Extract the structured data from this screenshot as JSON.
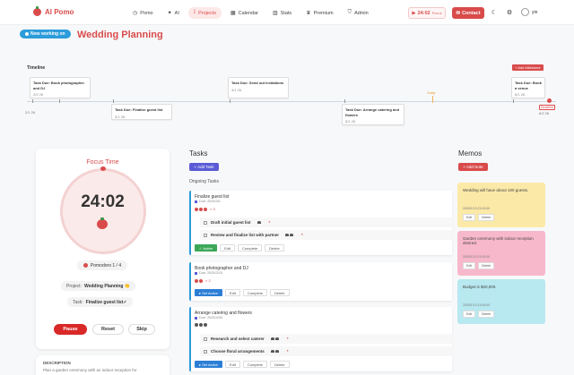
{
  "header": {
    "app_name": "AI Pomo",
    "nav": [
      {
        "icon": "clock-icon",
        "glyph": "◷",
        "label": "Pomo"
      },
      {
        "icon": "sparkle-icon",
        "glyph": "✦",
        "label": "AI"
      },
      {
        "icon": "projects-icon",
        "glyph": "⟟",
        "label": "Projects"
      },
      {
        "icon": "calendar-icon",
        "glyph": "▦",
        "label": "Calendar"
      },
      {
        "icon": "stats-icon",
        "glyph": "▥",
        "label": "Stats"
      },
      {
        "icon": "crown-icon",
        "glyph": "♛",
        "label": "Premium"
      },
      {
        "icon": "shield-icon",
        "glyph": "⛉",
        "label": "Admin"
      }
    ],
    "timer_pill": {
      "time": "24:02",
      "mode": "Focus"
    },
    "contact_label": "Contact",
    "user_initials": "yin"
  },
  "working_on": {
    "badge": "Now working on",
    "project": "Wedding Planning"
  },
  "timeline": {
    "label": "Timeline",
    "add_milestone": "+ Add Milestone",
    "today_label": "Today",
    "deadline_label": "Deadline",
    "start_date": "2/1 26",
    "end_date": "6/2 26",
    "milestones": [
      {
        "title": "Task Due: Book photographer and DJ",
        "date": "2/2 26"
      },
      {
        "title": "Task Due: Finalize guest list",
        "date": "3/1 26"
      },
      {
        "title": "Task Due: Send out invitations",
        "date": "4/1 26"
      },
      {
        "title": "Task Due: Arrange catering and flowers",
        "date": "5/1 26"
      },
      {
        "title": "Task Due: Book a venue",
        "date": "6/1 26"
      }
    ]
  },
  "focus": {
    "title": "Focus Time",
    "time": "24:02",
    "pomodoro": "Pomodoro 1 / 4",
    "project_label": "Project:",
    "project_value": "Wedding Planning 👏",
    "task_label": "Task:",
    "task_value": "Finalize guest list✓",
    "pause": "Pause",
    "reset": "Reset",
    "skip": "Skip",
    "description_heading": "DESCRIPTION",
    "description_text": "Plan a garden ceremony with an indoor reception for"
  },
  "tasks": {
    "title": "Tasks",
    "add_task": "+ Add Task",
    "ongoing_label": "Ongoing Tasks",
    "items": [
      {
        "name": "Finalize guest list",
        "due": "Due: 2025/3/1",
        "pomo_count": "× 3",
        "subtasks": [
          "Draft initial guest list",
          "Review and finalize list with partner"
        ],
        "primary_action": "✓ Active",
        "actions": [
          "Edit",
          "Complete",
          "Delete"
        ]
      },
      {
        "name": "Book photographer and DJ",
        "due": "Due: 2025/2/15",
        "pomo_count": "× 2",
        "subtasks": [],
        "primary_action": "▸ Set Active",
        "actions": [
          "Edit",
          "Complete",
          "Delete"
        ]
      },
      {
        "name": "Arrange catering and flowers",
        "due": "Due: 2025/4/30",
        "pomo_count": "",
        "subtasks": [
          "Research and select caterer",
          "Choose floral arrangements"
        ],
        "primary_action": "▸ Set Active",
        "actions": [
          "Edit",
          "Complete",
          "Delete"
        ]
      }
    ]
  },
  "memos": {
    "title": "Memos",
    "add_note": "+ Add Note",
    "items": [
      {
        "text": "Wedding will have about 100 guests.",
        "date": "2025/1/13 21:00:00",
        "color": "#fbe9a8",
        "actions": [
          "Edit",
          "Delete"
        ]
      },
      {
        "text": "Garden ceremony with indoor reception desired.",
        "date": "2025/1/13 21:00:00",
        "color": "#f7b8cc",
        "actions": [
          "Edit",
          "Delete"
        ]
      },
      {
        "text": "Budget is $20,000.",
        "date": "2025/1/13 21:00:00",
        "color": "#b8e8f0",
        "actions": [
          "Edit",
          "Delete"
        ]
      }
    ]
  }
}
